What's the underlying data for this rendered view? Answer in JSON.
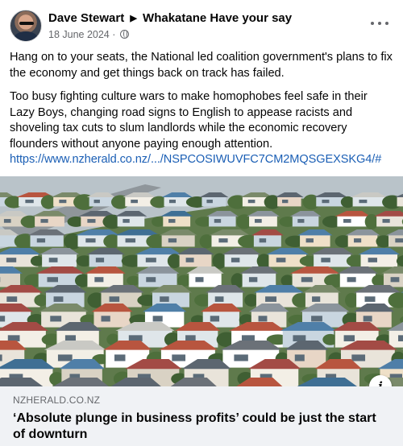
{
  "post": {
    "author": "Dave Stewart",
    "group": "Whakatane Have your say",
    "date": "18 June 2024",
    "paragraph1": "Hang on to your seats, the National led coalition government's plans to fix the economy and get things back on track has failed.",
    "paragraph2": "Too busy fighting culture wars to make homophobes feel safe in their Lazy Boys, changing road signs to English to appease racists and shoveling tax cuts to slum landlords while the economic recovery flounders without anyone paying enough attention.",
    "link": "https://www.nzherald.co.nz/.../NSPCOSIWUVFC7CM2MQSGEXSKG4/#"
  },
  "link_card": {
    "domain": "NZHERALD.CO.NZ",
    "headline": "‘Absolute plunge in business profits’ could be just the start of downturn"
  },
  "icons": {
    "group_arrow": "caret-right-icon",
    "privacy": "globe-icon",
    "more": "more-options-icon",
    "info": "info-icon"
  },
  "colors": {
    "link": "#1b5fb5",
    "secondary_text": "#65676b",
    "card_background": "#f0f2f5"
  }
}
